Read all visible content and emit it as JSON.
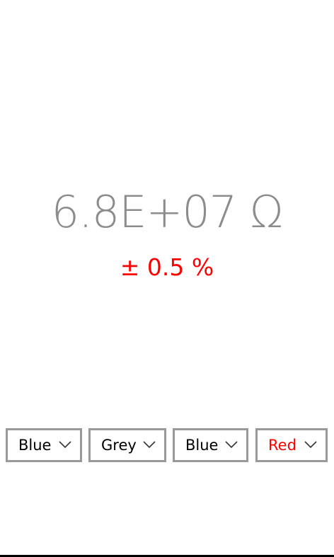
{
  "display": {
    "resistance": "6.8E+07 Ω",
    "tolerance": "± 0.5 %",
    "tolerance_color": "#ff0000",
    "resistance_color": "#8c8c8c"
  },
  "bands": [
    {
      "label": "Blue",
      "text_color": "#000000",
      "icon": "chevron-down-icon"
    },
    {
      "label": "Grey",
      "text_color": "#000000",
      "icon": "chevron-down-icon"
    },
    {
      "label": "Blue",
      "text_color": "#000000",
      "icon": "chevron-down-icon"
    },
    {
      "label": "Red",
      "text_color": "#ff0000",
      "icon": "chevron-down-icon"
    }
  ]
}
